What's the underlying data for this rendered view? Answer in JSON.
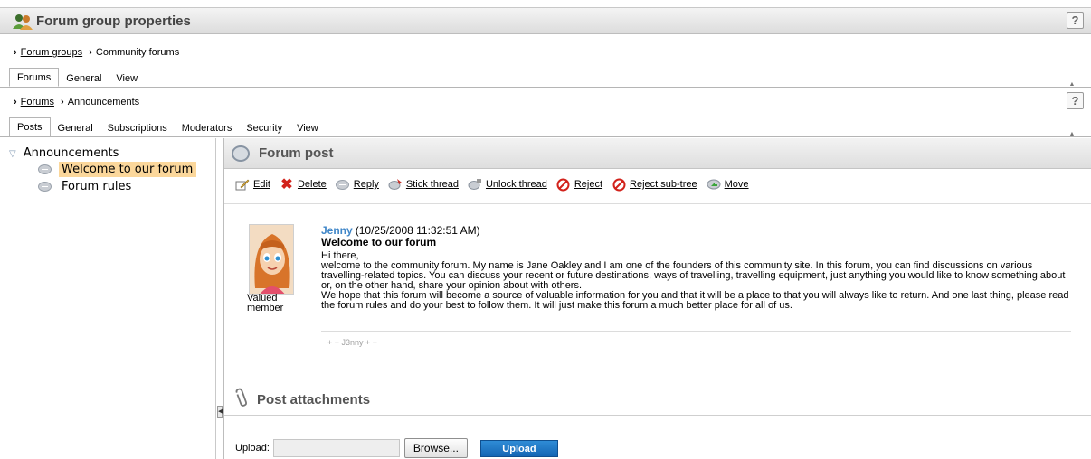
{
  "header": {
    "title": "Forum group properties",
    "help": "?"
  },
  "breadcrumb1": {
    "link": "Forum groups",
    "current": "Community forums"
  },
  "tabs1": [
    {
      "label": "Forums"
    },
    {
      "label": "General"
    },
    {
      "label": "View"
    }
  ],
  "breadcrumb2": {
    "link": "Forums",
    "current": "Announcements",
    "help": "?"
  },
  "tabs2": [
    {
      "label": "Posts"
    },
    {
      "label": "General"
    },
    {
      "label": "Subscriptions"
    },
    {
      "label": "Moderators"
    },
    {
      "label": "Security"
    },
    {
      "label": "View"
    }
  ],
  "tree": {
    "root": "Announcements",
    "items": [
      {
        "label": "Welcome to our forum"
      },
      {
        "label": "Forum rules"
      }
    ]
  },
  "post_section": {
    "title": "Forum post"
  },
  "toolbar": [
    {
      "label": "Edit"
    },
    {
      "label": "Delete"
    },
    {
      "label": "Reply"
    },
    {
      "label": "Stick thread"
    },
    {
      "label": "Unlock thread"
    },
    {
      "label": "Reject"
    },
    {
      "label": "Reject sub-tree"
    },
    {
      "label": "Move"
    }
  ],
  "post": {
    "author": "Jenny",
    "date": "(10/25/2008 11:32:51 AM)",
    "subject": "Welcome to our forum",
    "badge": "Valued member",
    "greeting": "Hi there,",
    "paragraph1": "welcome to the community forum. My name is Jane Oakley and I am one of the founders of this community site. In this forum, you can find discussions on various travelling-related topics. You can discuss your recent or future destinations, ways of travelling, travelling equipment, just anything you would like to know something about or, on the other hand, share your opinion about with others.",
    "paragraph2": "We hope that this forum will become a source of valuable information for you and that it will be a place to that you will always like to return. And one last thing, please read the forum rules and do your best to follow them. It will just make this forum a much better place for all of us.",
    "signature": "+ + J3nny + +"
  },
  "attachments": {
    "title": "Post attachments",
    "upload_label": "Upload:",
    "browse": "Browse...",
    "upload_button": "Upload"
  },
  "colors": {
    "author": "#3f86c8",
    "selected": "#fbd79b",
    "upload_button": "#1f77c6"
  }
}
